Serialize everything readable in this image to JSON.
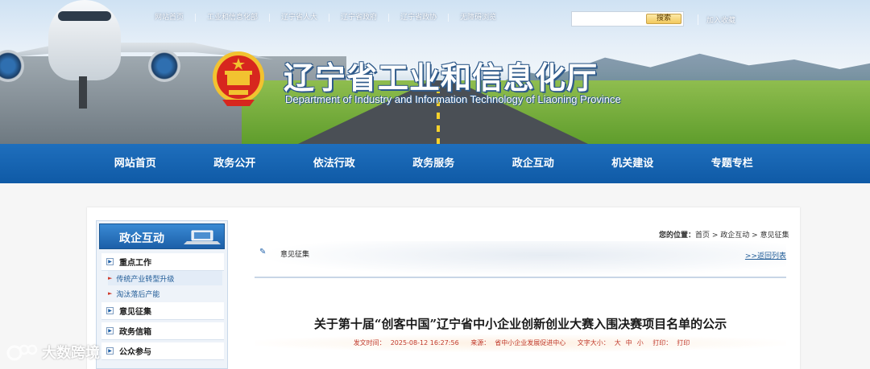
{
  "top_nav": [
    "网站首页",
    "工业和信息化部",
    "辽宁省人大",
    "辽宁省政府",
    "辽宁省政协",
    "无障碍浏览"
  ],
  "search": {
    "placeholder": "",
    "button": "搜索"
  },
  "favorite": "加入收藏",
  "site": {
    "title_cn": "辽宁省工业和信息化厅",
    "title_en": "Department of Industry and Information Technology of Liaoning Province"
  },
  "main_nav": [
    "网站首页",
    "政务公开",
    "依法行政",
    "政务服务",
    "政企互动",
    "机关建设",
    "专题专栏"
  ],
  "sidebar": {
    "title": "政企互动",
    "items": [
      {
        "label": "重点工作",
        "children": [
          "传统产业转型升级",
          "淘汰落后产能"
        ]
      },
      {
        "label": "意见征集"
      },
      {
        "label": "政务信箱"
      },
      {
        "label": "公众参与"
      }
    ]
  },
  "breadcrumb": {
    "prefix": "您的位置：",
    "items": [
      "首页",
      "政企互动",
      "意见征集"
    ],
    "separator": " > "
  },
  "section": {
    "title": "意见征集",
    "back": ">>返回列表"
  },
  "article": {
    "title": "关于第十届“创客中国”辽宁省中小企业创新创业大赛入围决赛项目名单的公示",
    "meta": {
      "date_label": "发文时间：",
      "date": "2025-08-12 16:27:56",
      "source_label": "来源：",
      "source": "省中小企业发展促进中心",
      "font_label": "文字大小：",
      "font_large": "大",
      "font_medium": "中",
      "font_small": "小",
      "print1": "打印：",
      "print2": "打印"
    }
  },
  "watermark": "大数跨境",
  "colors": {
    "nav_blue": "#0f5aa6",
    "sidebar_blue": "#1c5fa8",
    "meta_red": "#c0392b"
  }
}
